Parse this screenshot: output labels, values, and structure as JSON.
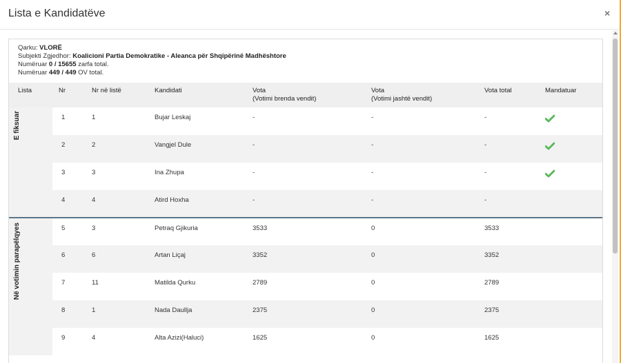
{
  "modal": {
    "title": "Lista e Kandidatëve",
    "close_label": "×"
  },
  "info": {
    "qarku_label": "Qarku:",
    "qarku_value": "VLORË",
    "subjekti_label": "Subjekti Zgjedhor:",
    "subjekti_value": "Koalicioni Partia Demokratike - Aleanca për Shqipërinë Madhështore",
    "zarfa_prefix": "Numëruar",
    "zarfa_value": "0 / 15655",
    "zarfa_suffix": "zarfa total.",
    "ov_prefix": "Numëruar",
    "ov_value": "449 / 449",
    "ov_suffix": "OV total."
  },
  "columns": {
    "lista": "Lista",
    "nr": "Nr",
    "nr_liste": "Nr në listë",
    "kandidati": "Kandidati",
    "vota_brenda_1": "Vota",
    "vota_brenda_2": "(Votimi brenda vendit)",
    "vota_jashte_1": "Vota",
    "vota_jashte_2": "(Votimi jashtë vendit)",
    "vota_total": "Vota total",
    "mandatuar": "Mandatuar"
  },
  "groups": [
    {
      "label": "E fiksuar"
    },
    {
      "label": "Në votimin parapëlqyes"
    }
  ],
  "rows": [
    {
      "nr": "1",
      "nr_liste": "1",
      "kandidati": "Bujar Leskaj",
      "brenda": "-",
      "jashte": "-",
      "total": "-",
      "mandatuar": true
    },
    {
      "nr": "2",
      "nr_liste": "2",
      "kandidati": "Vangjel Dule",
      "brenda": "-",
      "jashte": "-",
      "total": "-",
      "mandatuar": true
    },
    {
      "nr": "3",
      "nr_liste": "3",
      "kandidati": "Ina Zhupa",
      "brenda": "-",
      "jashte": "-",
      "total": "-",
      "mandatuar": true
    },
    {
      "nr": "4",
      "nr_liste": "4",
      "kandidati": "Atird Hoxha",
      "brenda": "-",
      "jashte": "-",
      "total": "-",
      "mandatuar": false
    },
    {
      "nr": "5",
      "nr_liste": "3",
      "kandidati": "Petraq Gjikuria",
      "brenda": "3533",
      "jashte": "0",
      "total": "3533",
      "mandatuar": false
    },
    {
      "nr": "6",
      "nr_liste": "6",
      "kandidati": "Artan Liçaj",
      "brenda": "3352",
      "jashte": "0",
      "total": "3352",
      "mandatuar": false
    },
    {
      "nr": "7",
      "nr_liste": "11",
      "kandidati": "Matilda Qurku",
      "brenda": "2789",
      "jashte": "0",
      "total": "2789",
      "mandatuar": false
    },
    {
      "nr": "8",
      "nr_liste": "1",
      "kandidati": "Nada Daullja",
      "brenda": "2375",
      "jashte": "0",
      "total": "2375",
      "mandatuar": false
    },
    {
      "nr": "9",
      "nr_liste": "4",
      "kandidati": "Alta Azizi(Haluci)",
      "brenda": "1625",
      "jashte": "0",
      "total": "1625",
      "mandatuar": false
    }
  ],
  "colors": {
    "check": "#5cb85c",
    "separator": "#5c7588",
    "accent_bar": "#f0a830"
  },
  "icons": {
    "mandatuar": "check-icon",
    "close": "close-icon"
  }
}
